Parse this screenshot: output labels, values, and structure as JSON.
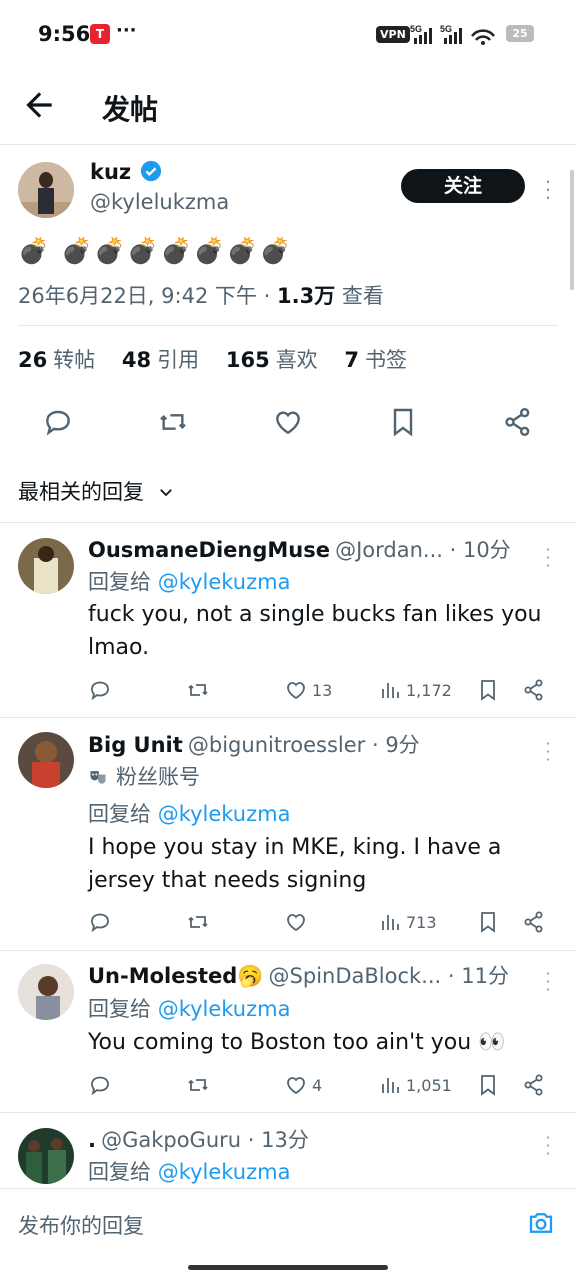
{
  "status": {
    "time": "9:56",
    "app_badge": "T",
    "dots": "···",
    "vpn": "VPN",
    "net1": "5G",
    "net2": "5G",
    "battery": "25"
  },
  "header": {
    "title": "发帖"
  },
  "post": {
    "name": "kuz",
    "handle": "@kylelukzma",
    "follow_label": "关注",
    "content": "💣 💣💣💣💣💣💣💣",
    "date": "26年6月22日, 9:42 下午 · ",
    "views": "1.3万",
    "views_label": " 查看",
    "stats": {
      "reposts": "26",
      "reposts_label": "转帖",
      "quotes": "48",
      "quotes_label": "引用",
      "likes": "165",
      "likes_label": "喜欢",
      "bookmarks": "7",
      "bookmarks_label": "书签"
    }
  },
  "sort": {
    "label": "最相关的回复"
  },
  "replies": [
    {
      "name": "OusmaneDiengMuse",
      "handle": "@Jordan...",
      "time": " · 10分",
      "reply_prefix": "回复给 ",
      "reply_to": "@kylekuzma",
      "text": "fuck you, not a single bucks fan likes you lmao.",
      "likes": "13",
      "views": "1,172"
    },
    {
      "name": "Big Unit",
      "handle": "@bigunitroessler",
      "time": " · 9分",
      "badge": "粉丝账号",
      "reply_prefix": "回复给 ",
      "reply_to": "@kylekuzma",
      "text": "I hope you stay in MKE, king. I have a jersey that needs signing",
      "likes": "",
      "views": "713"
    },
    {
      "name": "Un-Molested🥱",
      "handle": "@SpinDaBlock...",
      "time": " · 11分",
      "reply_prefix": "回复给 ",
      "reply_to": "@kylekuzma",
      "text": "You coming to Boston too ain't you 👀",
      "likes": "4",
      "views": "1,051"
    },
    {
      "name": ".",
      "handle": "@GakpoGuru",
      "time": " · 13分",
      "reply_prefix": "回复给 ",
      "reply_to": "@kylekuzma"
    }
  ],
  "composer": {
    "placeholder": "发布你的回复"
  }
}
